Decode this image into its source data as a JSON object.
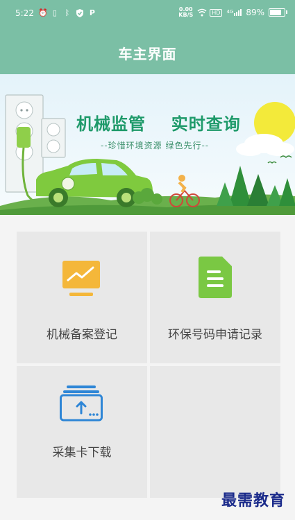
{
  "status_bar": {
    "time": "5:22",
    "net_speed_value": "0.00",
    "net_speed_unit": "KB/S",
    "hd_badge": "HD",
    "signal_label": "4G",
    "battery_percent_text": "89%",
    "battery_level": 0.89,
    "icons": [
      "alarm-icon",
      "vibrate-icon",
      "bluetooth-icon",
      "shield-icon",
      "p-icon",
      "wifi-icon",
      "signal-icon",
      "battery-icon"
    ]
  },
  "app_bar": {
    "title": "车主界面"
  },
  "banner": {
    "headline_left": "机械监管",
    "headline_right": "实时查询",
    "slogan": "--珍惜环境资源 绿色先行--"
  },
  "menu": {
    "items": [
      {
        "label": "机械备案登记",
        "icon": "chart-monitor-icon",
        "color": "#f4b73a"
      },
      {
        "label": "环保号码申请记录",
        "icon": "document-icon",
        "color": "#7ac843"
      },
      {
        "label": "采集卡下载",
        "icon": "card-upload-icon",
        "color": "#2e86d6"
      }
    ]
  },
  "watermark": "最需教育",
  "colors": {
    "header": "#7bbfa5",
    "tile_bg": "#e8e8e8",
    "page_bg": "#f4f4f4"
  }
}
